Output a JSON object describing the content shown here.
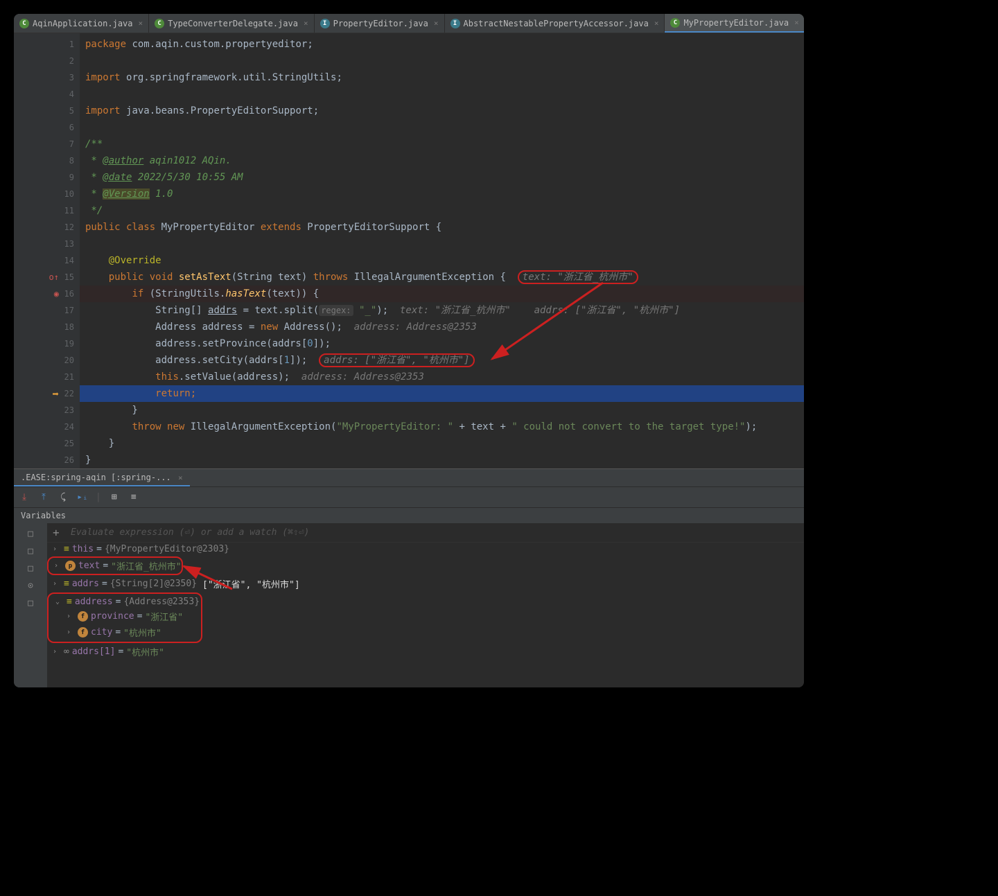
{
  "tabs": [
    {
      "label": "AqinApplication.java",
      "icon": "c"
    },
    {
      "label": "TypeConverterDelegate.java",
      "icon": "c"
    },
    {
      "label": "PropertyEditor.java",
      "icon": "i"
    },
    {
      "label": "AbstractNestablePropertyAccessor.java",
      "icon": "i"
    },
    {
      "label": "MyPropertyEditor.java",
      "icon": "c",
      "active": true
    }
  ],
  "code": {
    "package": "com.aqin.custom.propertyeditor",
    "import1": "org.springframework.util.StringUtils",
    "import2": "java.beans.PropertyEditorSupport",
    "author_tag": "@author",
    "author_val": "aqin1012 AQin.",
    "date_tag": "@date",
    "date_val": "2022/5/30 10:55 AM",
    "version_tag": "@Version",
    "version_val": "1.0",
    "class_name": "MyPropertyEditor",
    "extends": "PropertyEditorSupport",
    "override": "@Override",
    "method_sig_kw1": "public void",
    "method_name": "setAsText",
    "method_param": "String text",
    "throws": "IllegalArgumentException",
    "hint_text": "text: \"浙江省_杭州市\"",
    "if_cond": "StringUtils",
    "if_method": "hasText",
    "regex_hint": "regex:",
    "regex_val": "\"_\"",
    "line17_hint": "text: \"浙江省_杭州市\"    addrs: [\"浙江省\", \"杭州市\"]",
    "line18_hint": "address: Address@2353",
    "line20_hint": "addrs: [\"浙江省\", \"杭州市\"]",
    "line21_hint": "address: Address@2353",
    "exception_msg1": "\"MyPropertyEditor: \"",
    "exception_msg2": "\" could not convert to the target type!\""
  },
  "line_numbers": [
    "1",
    "2",
    "3",
    "4",
    "5",
    "6",
    "7",
    "8",
    "9",
    "10",
    "11",
    "12",
    "13",
    "14",
    "15",
    "16",
    "17",
    "18",
    "19",
    "20",
    "21",
    "22",
    "23",
    "24",
    "25",
    "26"
  ],
  "debug": {
    "tab_label": ".EASE:spring-aqin [:spring-...",
    "vars_label": "Variables",
    "eval_placeholder": "Evaluate expression (⏎) or add a watch (⌘⇧⏎)",
    "rows": {
      "this_name": "this",
      "this_val": "{MyPropertyEditor@2303}",
      "text_name": "text",
      "text_val": "\"浙江省_杭州市\"",
      "addrs_name": "addrs",
      "addrs_val": "{String[2]@2350}",
      "addrs_extra": "[\"浙江省\", \"杭州市\"]",
      "address_name": "address",
      "address_val": "{Address@2353}",
      "province_name": "province",
      "province_val": "\"浙江省\"",
      "city_name": "city",
      "city_val": "\"杭州市\"",
      "addrs1_name": "addrs[1]",
      "addrs1_val": "\"杭州市\""
    }
  }
}
